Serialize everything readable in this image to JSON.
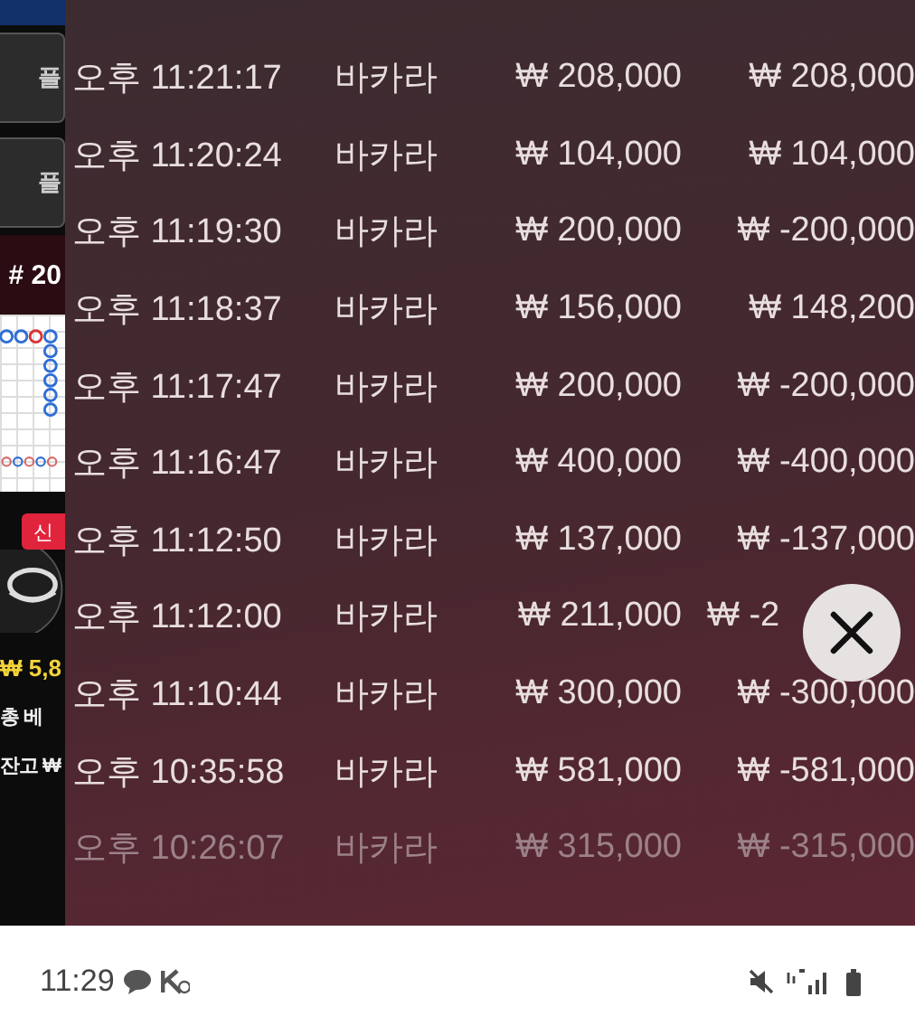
{
  "background_app": {
    "buttons": [
      {
        "label": "플"
      },
      {
        "label": "플"
      }
    ],
    "round_label": "# 20",
    "badge": "신",
    "amount": "₩ 5,8",
    "total_bet_label": "총 베",
    "balance_label": "잔고 ₩"
  },
  "history": {
    "rows": [
      {
        "time": "오후 11:21:17",
        "game": "바카라",
        "bet": "₩ 208,000",
        "result": "₩ 208,000",
        "dimmed": false
      },
      {
        "time": "오후 11:20:24",
        "game": "바카라",
        "bet": "₩ 104,000",
        "result": "₩ 104,000",
        "dimmed": false
      },
      {
        "time": "오후 11:19:30",
        "game": "바카라",
        "bet": "₩ 200,000",
        "result": "₩ -200,000",
        "dimmed": false
      },
      {
        "time": "오후 11:18:37",
        "game": "바카라",
        "bet": "₩ 156,000",
        "result": "₩ 148,200",
        "dimmed": false
      },
      {
        "time": "오후 11:17:47",
        "game": "바카라",
        "bet": "₩ 200,000",
        "result": "₩ -200,000",
        "dimmed": false
      },
      {
        "time": "오후 11:16:47",
        "game": "바카라",
        "bet": "₩ 400,000",
        "result": "₩ -400,000",
        "dimmed": false
      },
      {
        "time": "오후 11:12:50",
        "game": "바카라",
        "bet": "₩ 137,000",
        "result": "₩ -137,000",
        "dimmed": false
      },
      {
        "time": "오후 11:12:00",
        "game": "바카라",
        "bet": "₩ 211,000",
        "result": "₩ -2",
        "dimmed": false,
        "covered": true
      },
      {
        "time": "오후 11:10:44",
        "game": "바카라",
        "bet": "₩ 300,000",
        "result": "₩ -300,000",
        "dimmed": false
      },
      {
        "time": "오후 10:35:58",
        "game": "바카라",
        "bet": "₩ 581,000",
        "result": "₩ -581,000",
        "dimmed": false
      },
      {
        "time": "오후 10:26:07",
        "game": "바카라",
        "bet": "₩ 315,000",
        "result": "₩ -315,000",
        "dimmed": true
      }
    ]
  },
  "status_bar": {
    "time": "11:29"
  }
}
